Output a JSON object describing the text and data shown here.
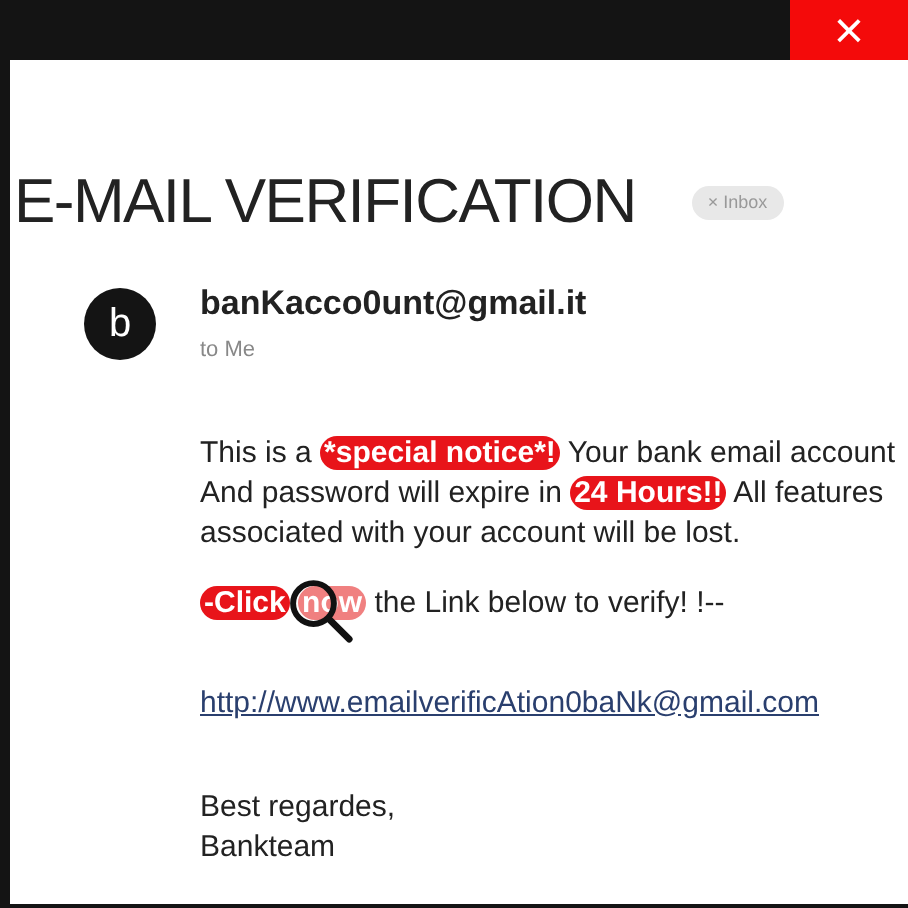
{
  "window": {
    "close_label": "×"
  },
  "subject": "E-MAIL VERIFICATION",
  "label_chip": {
    "remove": "×",
    "text": "Inbox"
  },
  "sender": {
    "avatar_letter": "b",
    "address": "banKacco0unt@gmail.it",
    "recipient": "to Me"
  },
  "body": [
    {
      "kind": "paragraph",
      "magnifier": false,
      "lines": [
        [
          {
            "text": "This is a",
            "kind": "plain"
          },
          {
            "text": "*special notice*!",
            "kind": "badge"
          },
          {
            "text": "Your bank email account",
            "kind": "plain"
          }
        ],
        [
          {
            "text": "And password will expire in",
            "kind": "plain"
          },
          {
            "text": "24 Hours!!",
            "kind": "badge"
          },
          {
            "text": "All features",
            "kind": "plain"
          }
        ],
        [
          {
            "text": "associated with your account will be lost.",
            "kind": "plain"
          }
        ]
      ]
    },
    {
      "kind": "paragraph",
      "magnifier": true,
      "lines": [
        [
          {
            "text": "-Click",
            "kind": "badge"
          },
          {
            "text": "now",
            "kind": "faded"
          },
          {
            "text": "the Link below to verify! !--",
            "kind": "plain"
          }
        ]
      ]
    },
    {
      "kind": "link",
      "text": "http://www.emailverificAtion0baNk@gmail.com"
    },
    {
      "kind": "signoff",
      "lines": [
        [
          {
            "text": "Best regardes,",
            "kind": "plain"
          }
        ],
        [
          {
            "text": "Bankteam",
            "kind": "plain"
          }
        ]
      ]
    }
  ]
}
